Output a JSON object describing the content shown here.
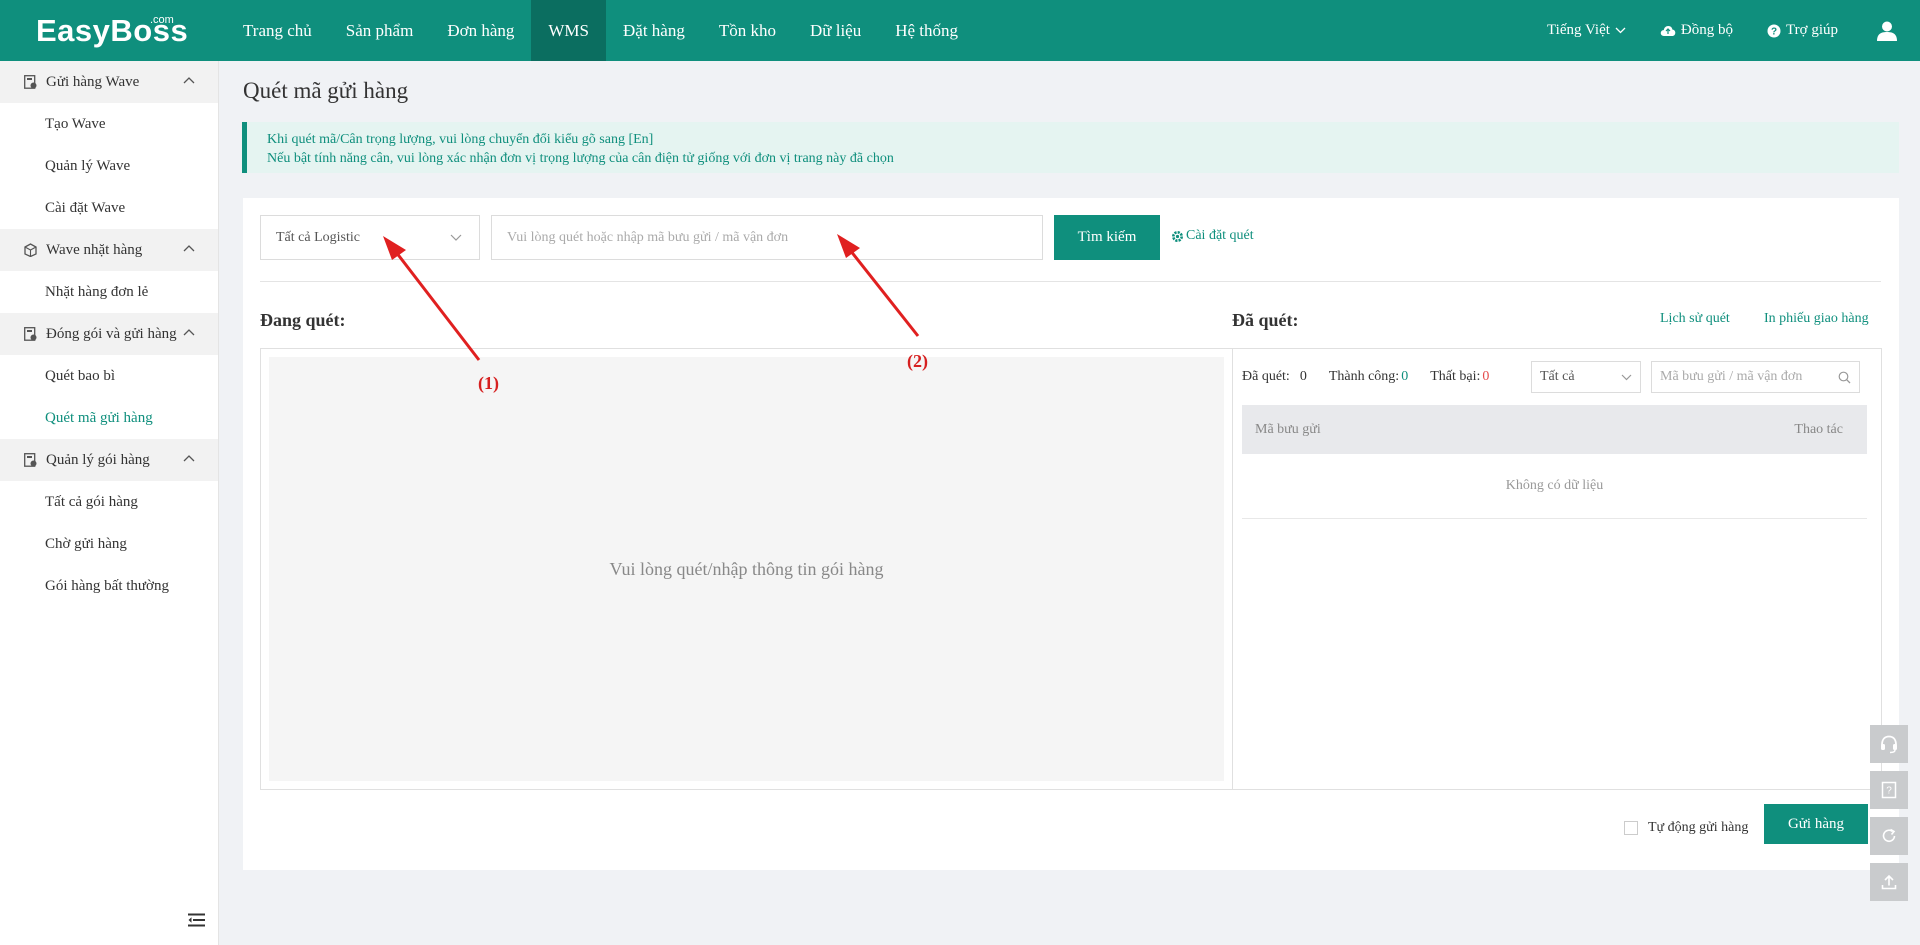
{
  "header": {
    "logo": "EasyBoss",
    "logo_suffix": ".com",
    "nav": [
      "Trang chủ",
      "Sản phẩm",
      "Đơn hàng",
      "WMS",
      "Đặt hàng",
      "Tồn kho",
      "Dữ liệu",
      "Hệ thống"
    ],
    "active_nav": "WMS",
    "language": "Tiếng Việt",
    "sync": "Đồng bộ",
    "help": "Trợ giúp"
  },
  "sidebar": {
    "groups": [
      {
        "title": "Gửi hàng Wave",
        "items": [
          "Tạo Wave",
          "Quản lý Wave",
          "Cài đặt Wave"
        ]
      },
      {
        "title": "Wave nhặt hàng",
        "items": [
          "Nhặt hàng đơn lẻ"
        ]
      },
      {
        "title": "Đóng gói và gửi hàng",
        "items": [
          "Quét bao bì",
          "Quét mã gửi hàng"
        ]
      },
      {
        "title": "Quản lý gói hàng",
        "items": [
          "Tất cả gói hàng",
          "Chờ gửi hàng",
          "Gói hàng bất thường"
        ]
      }
    ],
    "active_item": "Quét mã gửi hàng"
  },
  "page": {
    "title": "Quét mã gửi hàng",
    "notice_line1": "Khi quét mã/Cân trọng lượng, vui lòng chuyển đổi kiểu gõ sang [En]",
    "notice_line2": "Nếu bật tính năng cân, vui lòng xác nhận đơn vị trọng lượng của cân điện tử giống với đơn vị trang này đã chọn"
  },
  "search": {
    "logistic_value": "Tất cả Logistic",
    "scan_placeholder": "Vui lòng quét hoặc nhập mã bưu gửi / mã vận đơn",
    "search_button": "Tìm kiếm",
    "scan_settings": "Cài đặt quét"
  },
  "scanning": {
    "label": "Đang quét:",
    "empty_text": "Vui lòng quét/nhập thông tin gói hàng"
  },
  "scanned": {
    "label": "Đã quét:",
    "history_link": "Lịch sử quét",
    "print_link": "In phiếu giao hàng",
    "stat_scanned_label": "Đã quét:",
    "stat_scanned_value": "0",
    "stat_success_label": "Thành công:",
    "stat_success_value": "0",
    "stat_fail_label": "Thất bại:",
    "stat_fail_value": "0",
    "filter_value": "Tất cả",
    "search_placeholder": "Mã bưu gửi / mã vận đơn",
    "col_package": "Mã bưu gửi",
    "col_action": "Thao tác",
    "empty_text": "Không có dữ liệu"
  },
  "footer": {
    "auto_send": "Tự động gửi hàng",
    "send_button": "Gửi hàng"
  },
  "annotations": [
    "(1)",
    "(2)"
  ],
  "colors": {
    "brand": "#0f8f7d",
    "brand_dark": "#0b6e60",
    "fail": "#e54b4b",
    "annotation": "#d62020"
  }
}
